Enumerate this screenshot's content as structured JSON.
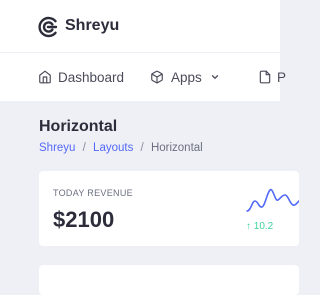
{
  "brand": {
    "name": "Shreyu",
    "logo_icon": "shreyu-logo-icon"
  },
  "menu": {
    "items": [
      {
        "label": "Dashboard",
        "icon": "home-icon"
      },
      {
        "label": "Apps",
        "icon": "box-icon",
        "dropdown": true
      },
      {
        "label": "P",
        "icon": "file-icon"
      }
    ]
  },
  "page": {
    "title": "Horizontal",
    "breadcrumb": [
      "Shreyu",
      "Layouts",
      "Horizontal"
    ],
    "breadcrumb_separator": "/"
  },
  "widgets": [
    {
      "label": "TODAY REVENUE",
      "value": "$2100",
      "trend_arrow": "↑",
      "trend_value": "10.2"
    }
  ],
  "colors": {
    "accent": "#5369f8",
    "success": "#43d39e",
    "background": "#eef0f6"
  }
}
